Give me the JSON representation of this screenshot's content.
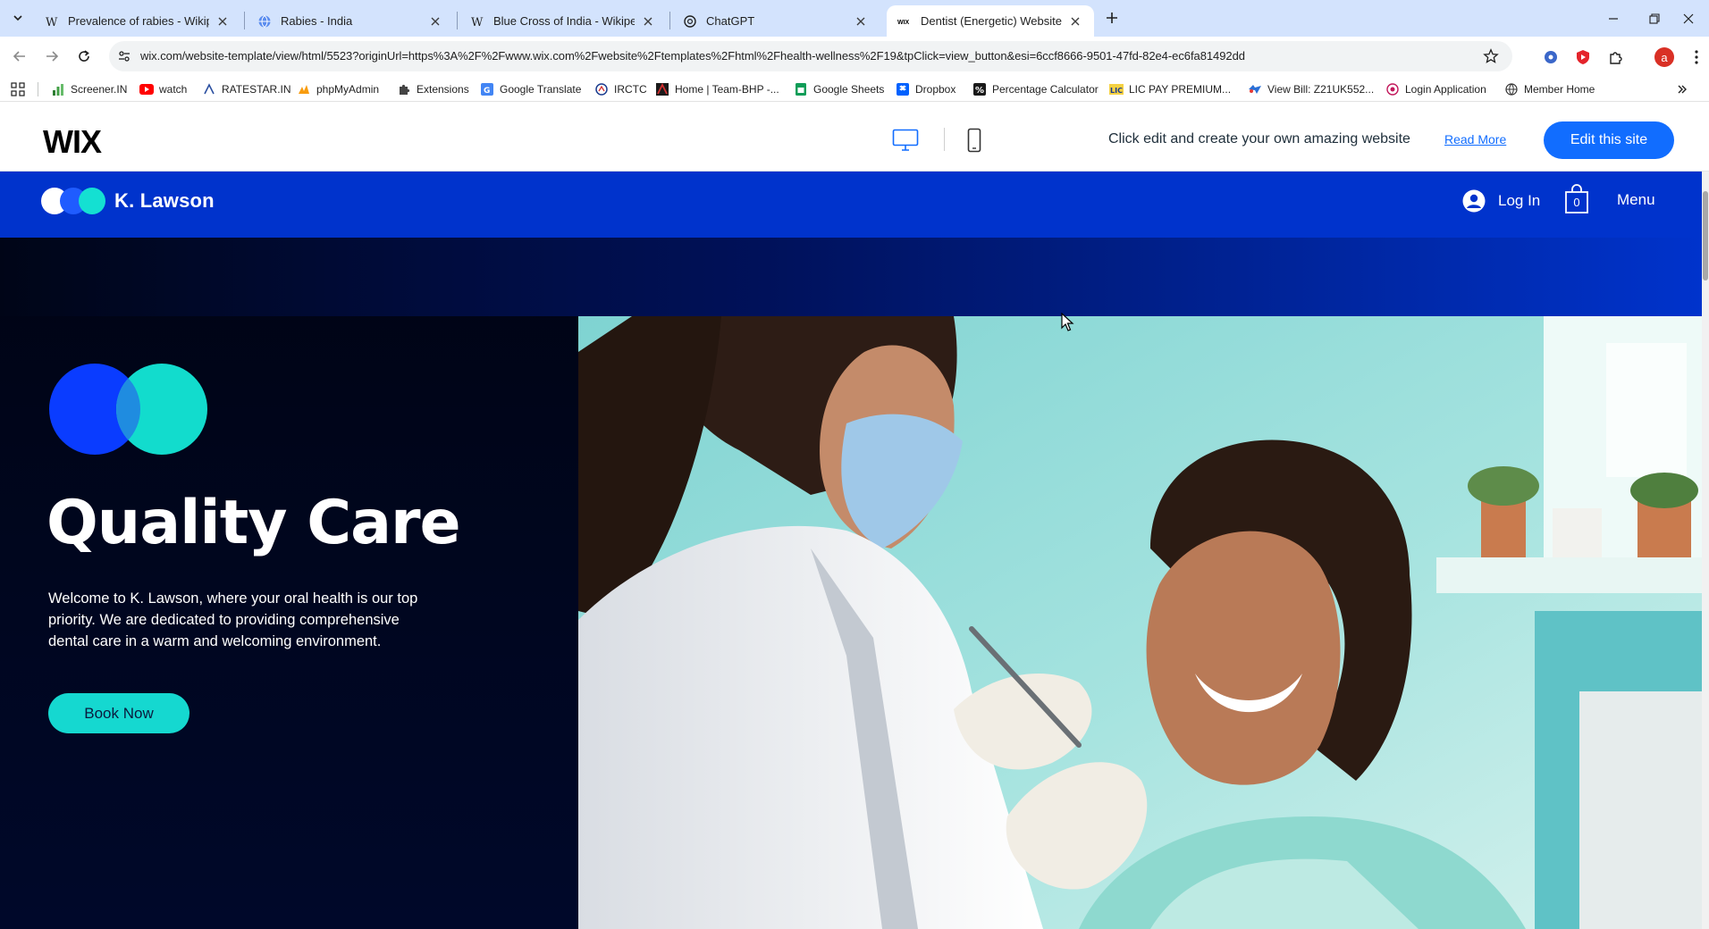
{
  "browser": {
    "tabs": [
      {
        "title": "Prevalence of rabies - Wikipedia",
        "icon": "wikipedia-icon"
      },
      {
        "title": "Rabies - India",
        "icon": "globe-icon"
      },
      {
        "title": "Blue Cross of India - Wikipedia",
        "icon": "wikipedia-icon"
      },
      {
        "title": "ChatGPT",
        "icon": "chatgpt-icon"
      },
      {
        "title": "Dentist (Energetic) Website Template",
        "icon": "wix-icon",
        "active": true
      }
    ],
    "url": "wix.com/website-template/view/html/5523?originUrl=https%3A%2F%2Fwww.wix.com%2Fwebsite%2Ftemplates%2Fhtml%2Fhealth-wellness%2F19&tpClick=view_button&esi=6ccf8666-9501-47fd-82e4-ec6fa81492dd",
    "avatar_letter": "a",
    "bookmarks": [
      {
        "label": "Screener.IN",
        "icon": "chart-icon"
      },
      {
        "label": "watch",
        "icon": "youtube-icon"
      },
      {
        "label": "RATESTAR.IN",
        "icon": "star-icon"
      },
      {
        "label": "phpMyAdmin",
        "icon": "database-icon"
      },
      {
        "label": "Extensions",
        "icon": "puzzle-icon"
      },
      {
        "label": "Google Translate",
        "icon": "translate-icon"
      },
      {
        "label": "IRCTC",
        "icon": "train-icon"
      },
      {
        "label": "Home | Team-BHP -...",
        "icon": "teambhp-icon"
      },
      {
        "label": "Google Sheets",
        "icon": "sheets-icon"
      },
      {
        "label": "Dropbox",
        "icon": "dropbox-icon"
      },
      {
        "label": "Percentage Calculator",
        "icon": "percent-icon"
      },
      {
        "label": "LIC PAY PREMIUM...",
        "icon": "lic-icon"
      },
      {
        "label": "View Bill: Z21UK552...",
        "icon": "bill-icon"
      },
      {
        "label": "Login Application",
        "icon": "login-icon"
      },
      {
        "label": "Member Home",
        "icon": "globe-icon"
      }
    ]
  },
  "wixbar": {
    "logo": "WIX",
    "message": "Click edit and create your own amazing website",
    "read_more": "Read More",
    "edit_button": "Edit this site"
  },
  "site": {
    "brand": "K. Lawson",
    "login": "Log In",
    "cart_count": "0",
    "menu": "Menu",
    "hero": {
      "title": "Quality Care",
      "text": "Welcome to K. Lawson, where your oral health is our top priority. We are dedicated to providing comprehensive dental care in a warm and welcoming environment.",
      "cta": "Book Now"
    }
  },
  "colors": {
    "header_blue": "#0033cc",
    "accent_teal": "#15d8d0",
    "wix_blue": "#116dff",
    "hero_dark": "#00082a"
  }
}
